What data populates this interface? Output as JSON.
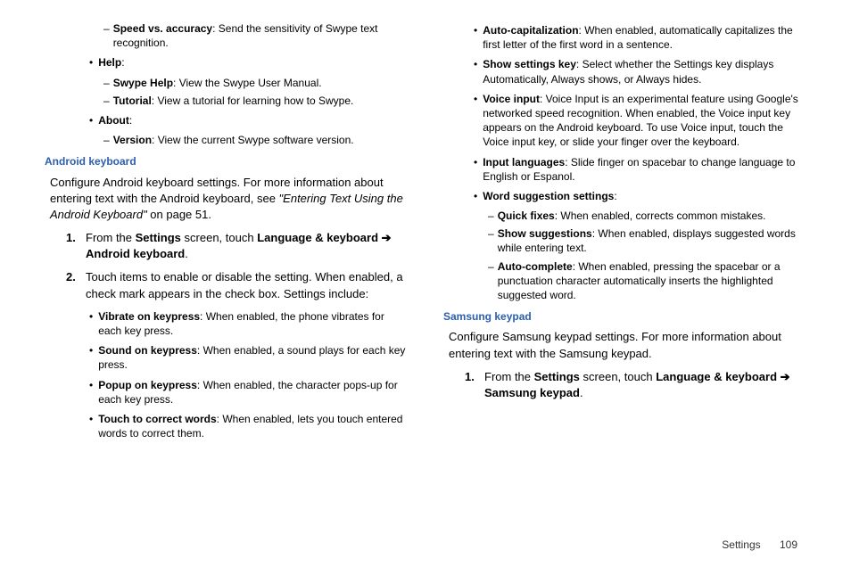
{
  "col1": {
    "speed_vs": {
      "t": "Speed vs. accuracy",
      "d": ": Send the sensitivity of Swype text recognition."
    },
    "help": {
      "t": "Help",
      "d": ":"
    },
    "swype_help": {
      "t": "Swype Help",
      "d": ": View the Swype User Manual."
    },
    "tutorial": {
      "t": "Tutorial",
      "d": ": View a tutorial for learning how to Swype."
    },
    "about": {
      "t": "About",
      "d": ":"
    },
    "version": {
      "t": "Version",
      "d": ": View the current Swype software version."
    },
    "heading1": "Android keyboard",
    "para1_a": "Configure Android keyboard settings.  For more information about entering text with the Android keyboard, see ",
    "para1_i": "\"Entering Text Using the Android Keyboard\"",
    "para1_b": " on page 51.",
    "step1_a": "From the ",
    "step1_b": "Settings",
    "step1_c": " screen, touch ",
    "step1_d": "Language & keyboard ",
    "step1_arrow": "➔",
    "step1_e": " Android keyboard",
    "step1_f": ".",
    "step2": "Touch items to enable or disable the setting. When enabled, a check mark appears in the check box. Settings include:",
    "vibrate": {
      "t": "Vibrate on keypress",
      "d": ": When enabled, the phone vibrates for each key press."
    },
    "sound": {
      "t": "Sound on keypress",
      "d": ": When enabled, a sound plays for each key press."
    },
    "popup": {
      "t": "Popup on keypress",
      "d": ": When enabled, the character pops-up for each key press."
    },
    "touch": {
      "t": "Touch to correct words",
      "d": ": When enabled, lets you touch entered words to correct them."
    }
  },
  "col2": {
    "autocap": {
      "t": "Auto-capitalization",
      "d": ": When enabled, automatically capitalizes the first letter of the first word in a sentence."
    },
    "showkey": {
      "t": "Show settings key",
      "d": ": Select whether the Settings key displays Automatically, Always shows, or Always hides."
    },
    "voice": {
      "t": "Voice input",
      "d": ": Voice Input is an experimental feature using Google's networked speed recognition. When enabled, the Voice input key appears on the Android keyboard. To use Voice input, touch the Voice input key, or slide your finger over the keyboard."
    },
    "inputlang": {
      "t": "Input languages",
      "d": ": Slide finger on spacebar to change language to English or Espanol."
    },
    "wordsug": {
      "t": "Word suggestion settings",
      "d": ":"
    },
    "quick": {
      "t": "Quick fixes",
      "d": ": When enabled, corrects common mistakes."
    },
    "showsug": {
      "t": "Show suggestions",
      "d": ": When enabled, displays suggested words while entering text."
    },
    "autocomp": {
      "t": "Auto-complete",
      "d": ": When enabled, pressing the spacebar or a punctuation character automatically inserts the highlighted suggested word."
    },
    "heading2": "Samsung keypad",
    "para2": "Configure Samsung keypad settings.  For more information about entering text with the Samsung keypad.",
    "step1_a": "From the ",
    "step1_b": "Settings",
    "step1_c": " screen, touch ",
    "step1_d": "Language & keyboard ",
    "step1_arrow": "➔",
    "step1_e": " Samsung keypad",
    "step1_f": "."
  },
  "footer": {
    "section": "Settings",
    "page": "109"
  }
}
